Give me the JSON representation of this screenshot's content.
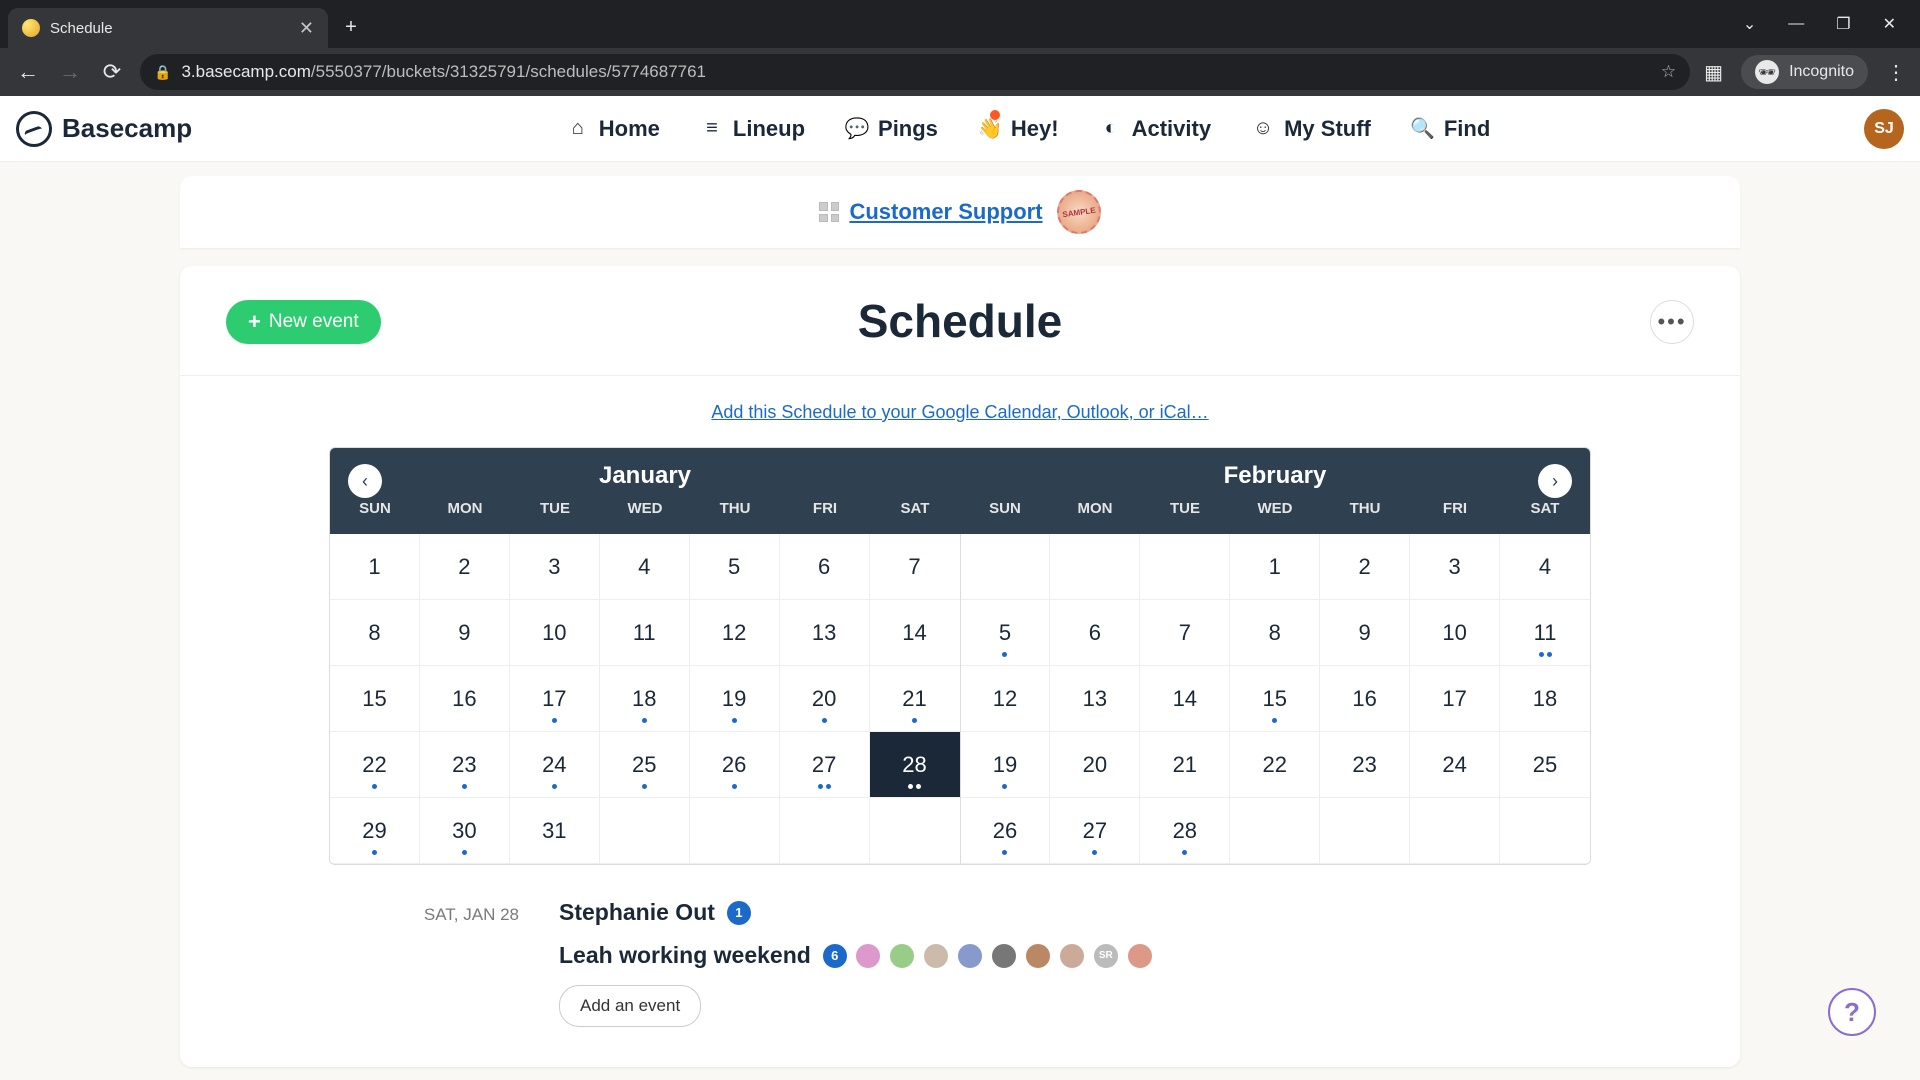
{
  "browser": {
    "tab_title": "Schedule",
    "url_host": "3.basecamp.com",
    "url_path": "/5550377/buckets/31325791/schedules/5774687761",
    "incognito_label": "Incognito"
  },
  "nav": {
    "logo": "Basecamp",
    "items": [
      {
        "label": "Home",
        "icon": "home"
      },
      {
        "label": "Lineup",
        "icon": "lineup"
      },
      {
        "label": "Pings",
        "icon": "pings"
      },
      {
        "label": "Hey!",
        "icon": "hey",
        "notification": true
      },
      {
        "label": "Activity",
        "icon": "activity"
      },
      {
        "label": "My Stuff",
        "icon": "mystuff"
      },
      {
        "label": "Find",
        "icon": "find"
      }
    ],
    "avatar_initials": "SJ"
  },
  "project": {
    "name": "Customer Support",
    "sample_badge": "SAMPLE"
  },
  "schedule": {
    "new_event_label": "New event",
    "title": "Schedule",
    "sync_link": "Add this Schedule to your Google Calendar, Outlook, or iCal…",
    "months": {
      "left": "January",
      "right": "February"
    },
    "dow": [
      "SUN",
      "MON",
      "TUE",
      "WED",
      "THU",
      "FRI",
      "SAT"
    ],
    "jan_days": [
      {
        "n": 1
      },
      {
        "n": 2
      },
      {
        "n": 3
      },
      {
        "n": 4
      },
      {
        "n": 5
      },
      {
        "n": 6
      },
      {
        "n": 7
      },
      {
        "n": 8
      },
      {
        "n": 9
      },
      {
        "n": 10
      },
      {
        "n": 11
      },
      {
        "n": 12
      },
      {
        "n": 13
      },
      {
        "n": 14
      },
      {
        "n": 15
      },
      {
        "n": 16
      },
      {
        "n": 17,
        "dots": 1
      },
      {
        "n": 18,
        "dots": 1
      },
      {
        "n": 19,
        "dots": 1
      },
      {
        "n": 20,
        "dots": 1
      },
      {
        "n": 21,
        "dots": 1
      },
      {
        "n": 22,
        "dots": 1
      },
      {
        "n": 23,
        "dots": 1
      },
      {
        "n": 24,
        "dots": 1
      },
      {
        "n": 25,
        "dots": 1
      },
      {
        "n": 26,
        "dots": 1
      },
      {
        "n": 27,
        "dots": 2
      },
      {
        "n": 28,
        "dots": 2,
        "today": true
      },
      {
        "n": 29,
        "dots": 1
      },
      {
        "n": 30,
        "dots": 1
      },
      {
        "n": 31
      }
    ],
    "feb_leading_blanks": 3,
    "feb_days": [
      {
        "n": 1
      },
      {
        "n": 2
      },
      {
        "n": 3
      },
      {
        "n": 4
      },
      {
        "n": 5,
        "dots": 1
      },
      {
        "n": 6
      },
      {
        "n": 7
      },
      {
        "n": 8
      },
      {
        "n": 9
      },
      {
        "n": 10
      },
      {
        "n": 11,
        "dots": 2
      },
      {
        "n": 12
      },
      {
        "n": 13
      },
      {
        "n": 14
      },
      {
        "n": 15,
        "dots": 1
      },
      {
        "n": 16
      },
      {
        "n": 17
      },
      {
        "n": 18
      },
      {
        "n": 19,
        "dots": 1
      },
      {
        "n": 20
      },
      {
        "n": 21
      },
      {
        "n": 22
      },
      {
        "n": 23
      },
      {
        "n": 24
      },
      {
        "n": 25
      },
      {
        "n": 26,
        "dots": 1
      },
      {
        "n": 27,
        "dots": 1
      },
      {
        "n": 28,
        "dots": 1
      }
    ],
    "selected_date_label": "SAT, JAN 28",
    "events": [
      {
        "title": "Stephanie Out",
        "count": 1,
        "avatars": 0
      },
      {
        "title": "Leah working weekend",
        "count": 6,
        "avatars": 9
      }
    ],
    "add_event_label": "Add an event"
  }
}
